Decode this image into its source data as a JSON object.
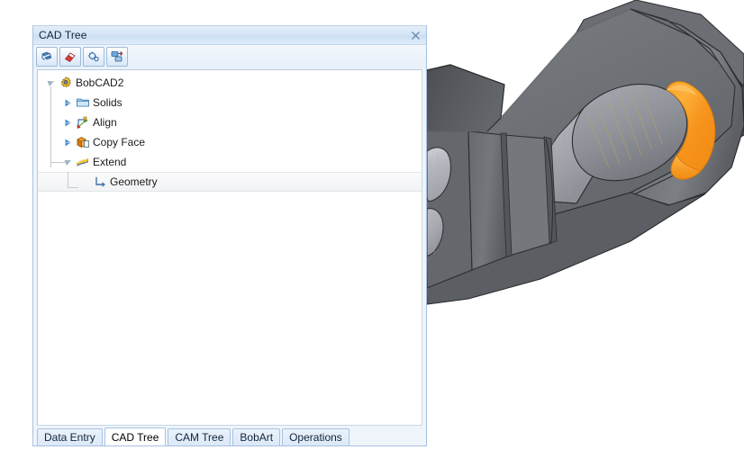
{
  "panel": {
    "title": "CAD Tree",
    "close_label": "Close",
    "close_icon": "close-icon",
    "toolbar": [
      {
        "name": "refresh-tree-button",
        "icon": "refresh-icon",
        "tooltip": "Refresh"
      },
      {
        "name": "erase-button",
        "icon": "eraser-icon",
        "tooltip": "Erase"
      },
      {
        "name": "settings-button",
        "icon": "gears-icon",
        "tooltip": "Settings"
      },
      {
        "name": "display-filter-button",
        "icon": "layers-icon",
        "tooltip": "Display"
      }
    ]
  },
  "tree": {
    "items": [
      {
        "label": "BobCAD2",
        "icon": "gear-icon",
        "level": 0,
        "expander": "expanded",
        "selected": false
      },
      {
        "label": "Solids",
        "icon": "folder-icon",
        "level": 1,
        "expander": "collapsed",
        "selected": false
      },
      {
        "label": "Align",
        "icon": "align-axes-icon",
        "level": 1,
        "expander": "collapsed",
        "selected": false
      },
      {
        "label": "Copy Face",
        "icon": "copy-face-icon",
        "level": 1,
        "expander": "collapsed",
        "selected": false
      },
      {
        "label": "Extend",
        "icon": "extend-icon",
        "level": 1,
        "expander": "expanded",
        "selected": false
      },
      {
        "label": "Geometry",
        "icon": "geometry-icon",
        "level": 2,
        "expander": "none",
        "selected": true
      }
    ]
  },
  "tabs": [
    {
      "label": "Data Entry",
      "active": false
    },
    {
      "label": "CAD Tree",
      "active": true
    },
    {
      "label": "CAM Tree",
      "active": false
    },
    {
      "label": "BobArt",
      "active": false
    },
    {
      "label": "Operations",
      "active": false
    }
  ],
  "viewport": {
    "name": "cad-3d-viewport",
    "background": "#ffffff",
    "model_color": "#6e7073",
    "model_color_dark": "#53565a",
    "model_color_light": "#84878b",
    "highlight_color": "#f79a20",
    "highlight_color_light": "#fcb944",
    "bore_color": "#b9bcc2",
    "edge_color": "#2b2d30"
  },
  "colors": {
    "titlebar_top": "#e4eefa",
    "titlebar_bottom": "#dfecfa",
    "panel_border": "#a8c2df",
    "tab_active_bg": "#ffffff",
    "tab_inactive_bg": "#dce9f8",
    "selection_bg": "#f2f3f5"
  }
}
